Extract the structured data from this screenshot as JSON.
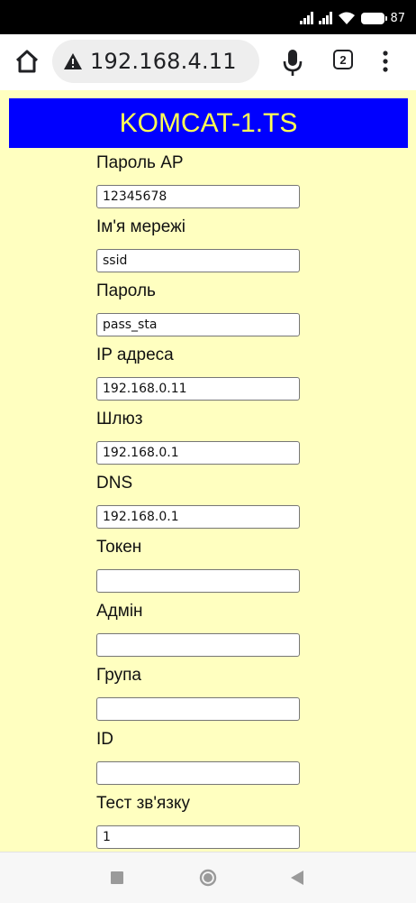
{
  "status_bar": {
    "battery_text": "87"
  },
  "browser": {
    "url": "192.168.4.11",
    "tab_count": "2"
  },
  "page": {
    "title": "KOMCAT-1.TS",
    "colors": {
      "background": "#ffffc0",
      "banner_bg": "#0000ff",
      "banner_text": "#ffff55"
    },
    "fields": [
      {
        "label": "Пароль AP",
        "value": "12345678"
      },
      {
        "label": "Ім'я мережі",
        "value": "ssid"
      },
      {
        "label": "Пароль",
        "value": "pass_sta"
      },
      {
        "label": "IP адреса",
        "value": "192.168.0.11"
      },
      {
        "label": "Шлюз",
        "value": "192.168.0.1"
      },
      {
        "label": "DNS",
        "value": "192.168.0.1"
      },
      {
        "label": "Токен",
        "value": ""
      },
      {
        "label": "Адмін",
        "value": ""
      },
      {
        "label": "Група",
        "value": ""
      },
      {
        "label": "ID",
        "value": ""
      },
      {
        "label": "Тест зв'язку",
        "value": "1"
      },
      {
        "label": "",
        "value": ""
      }
    ]
  }
}
